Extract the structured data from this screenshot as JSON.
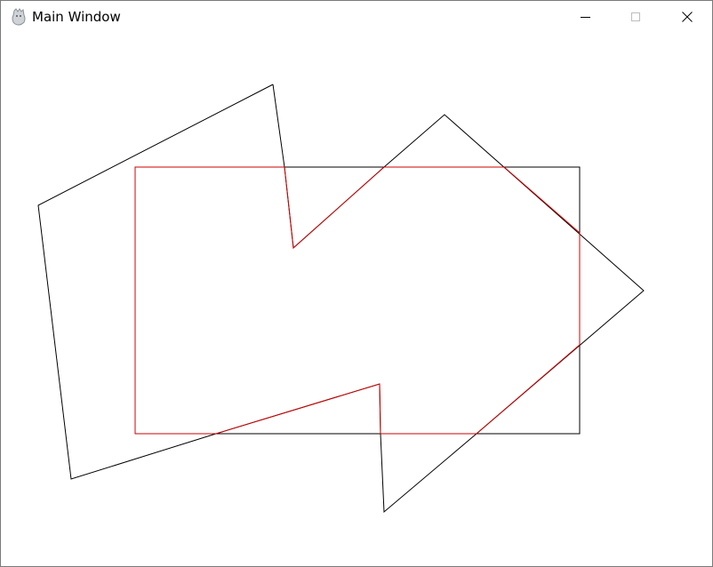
{
  "window": {
    "title": "Main Window",
    "icon": "app-logo-icon",
    "controls": [
      "minimize-icon",
      "maximize-icon",
      "close-icon"
    ]
  },
  "colors": {
    "shape_outline": "#000000",
    "clip_outline": "#d00000",
    "background": "#ffffff"
  }
}
